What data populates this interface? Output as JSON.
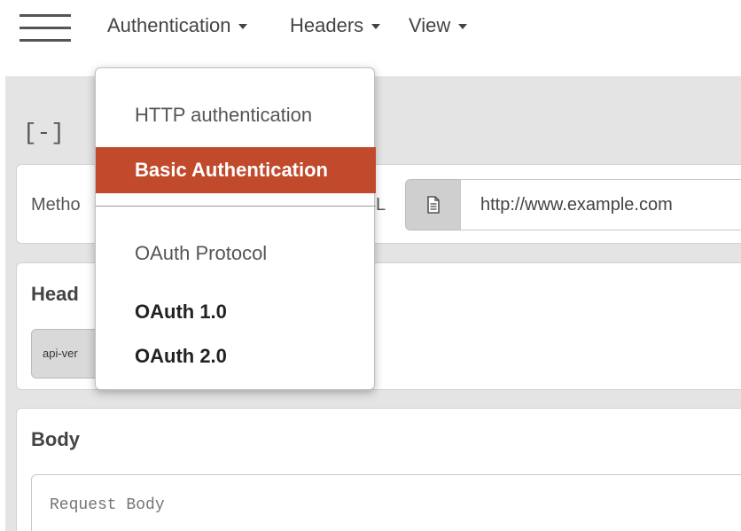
{
  "nav": {
    "authentication": "Authentication",
    "headers": "Headers",
    "view": "View"
  },
  "collapse_toggle": "[-]",
  "request": {
    "method_label": "Metho",
    "url_label_fragment": "L",
    "url_value": "http://www.example.com"
  },
  "headers_panel": {
    "title": "Head",
    "chip": "api-ver"
  },
  "body_panel": {
    "title": "Body",
    "placeholder": "Request Body"
  },
  "auth_menu": {
    "http_header": "HTTP authentication",
    "basic": "Basic Authentication",
    "oauth_header": "OAuth Protocol",
    "oauth1": "OAuth 1.0",
    "oauth2": "OAuth 2.0"
  },
  "colors": {
    "accent": "#c04a2b",
    "background": "#e4e4e4"
  },
  "icons": {
    "menu": "hamburger-icon",
    "url_addon": "document-icon",
    "caret": "caret-down-icon"
  }
}
